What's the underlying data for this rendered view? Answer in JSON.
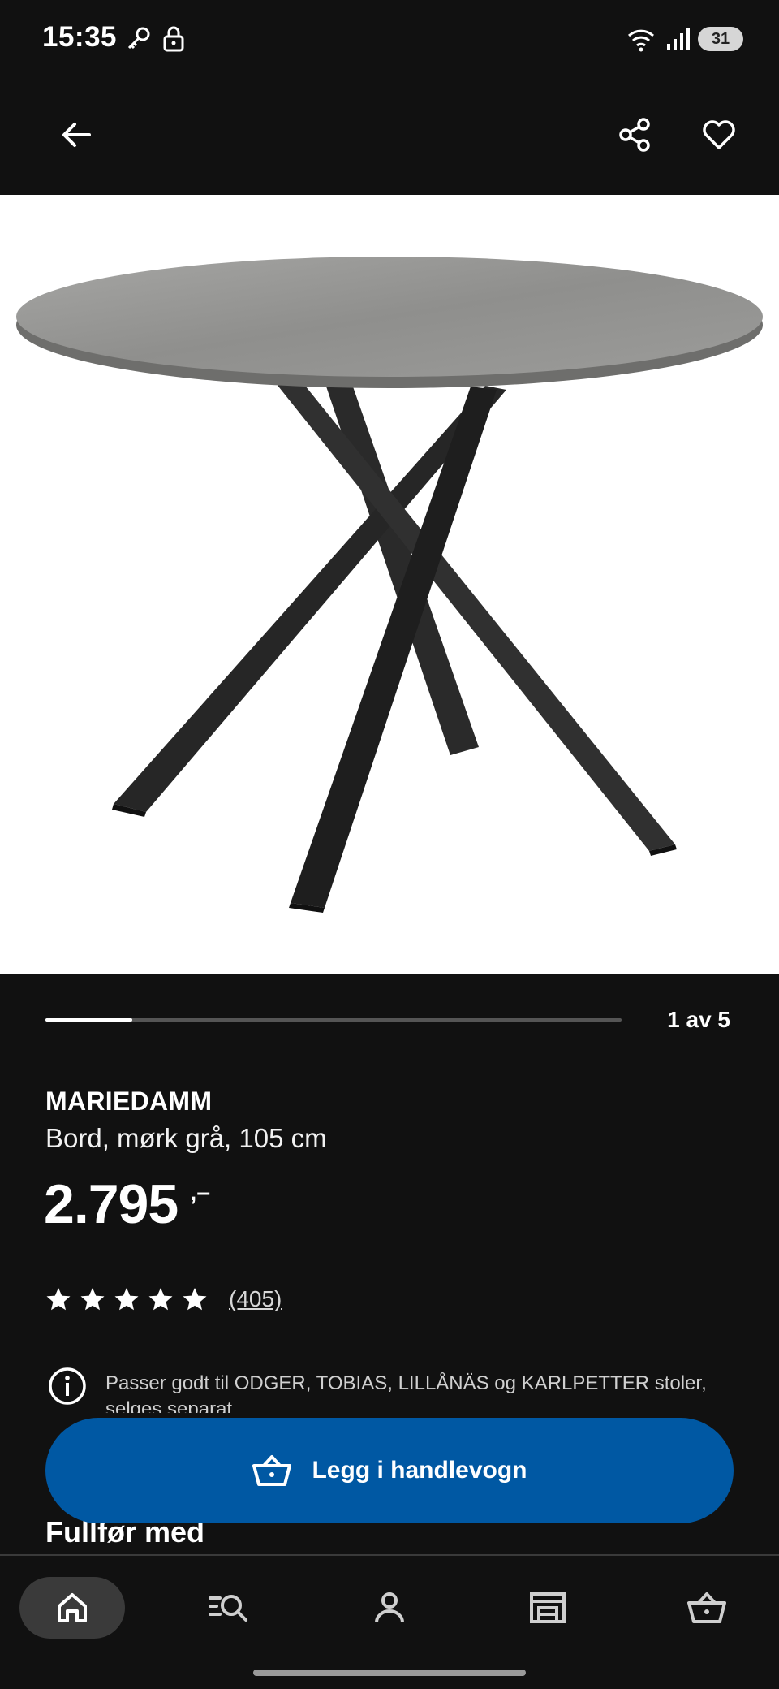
{
  "status_bar": {
    "time": "15:35",
    "battery": "31",
    "icons": [
      "key-icon",
      "lock-icon",
      "wifi-icon",
      "signal-icon",
      "battery-icon"
    ]
  },
  "app_bar": {
    "icons": [
      "back-arrow-icon",
      "share-icon",
      "heart-icon"
    ]
  },
  "gallery": {
    "position_label": "1 av 5",
    "progress_fraction": 0.15
  },
  "product": {
    "name": "MARIEDAMM",
    "description": "Bord, mørk grå, 105 cm",
    "price": "2.795",
    "price_suffix": ",–",
    "rating": {
      "stars": 5,
      "review_count": "(405)"
    },
    "info_text": "Passer godt til ODGER, TOBIAS, LILLÅNÄS og KARLPETTER stoler, selges separat."
  },
  "cta": {
    "add_to_cart_label": "Legg i handlevogn",
    "color": "#0058a3"
  },
  "section": {
    "title": "Fullfør med"
  },
  "bottom_nav": {
    "items": [
      {
        "icon": "home-icon",
        "active": true
      },
      {
        "icon": "search-list-icon",
        "active": false
      },
      {
        "icon": "profile-icon",
        "active": false
      },
      {
        "icon": "store-icon",
        "active": false
      },
      {
        "icon": "cart-icon",
        "active": false
      }
    ]
  }
}
